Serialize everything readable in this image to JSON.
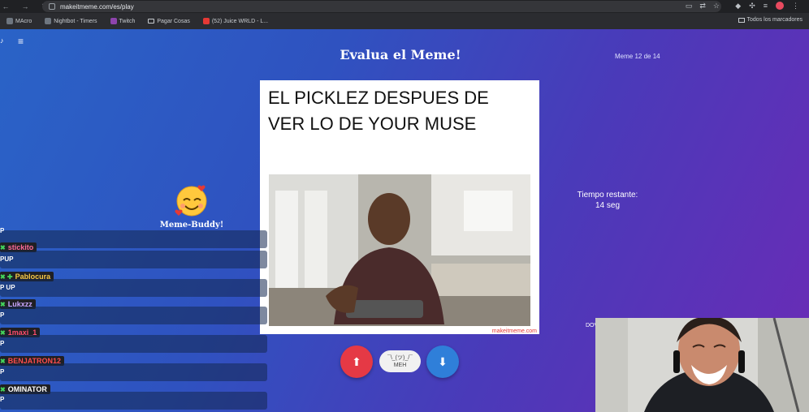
{
  "browser": {
    "url": "makeitmeme.com/es/play",
    "bookmarks": [
      "MAcro",
      "Nightbot - Timers",
      "Twitch",
      "Pagar Cosas",
      "(52) Juice WRLD - L..."
    ],
    "all_bookmarks": "Todos los marcadores"
  },
  "header": {
    "title": "Evalua el Meme!",
    "counter": "Meme 12 de 14"
  },
  "timer": {
    "label": "Tiempo restante:",
    "value": "14 seg"
  },
  "buddy": {
    "label": "Meme-Buddy!"
  },
  "meme": {
    "line1": "EL PICKLEZ DESPUES DE",
    "line2": "VER LO DE  YOUR MUSE",
    "watermark": "makeitmeme.com"
  },
  "vote": {
    "meh_face": "¯\\_(ツ)_/¯",
    "meh_label": "MEH"
  },
  "side_text": "DOV",
  "chat": [
    {
      "user": "",
      "msg": "P"
    },
    {
      "user": "stickito",
      "msg": "PUP",
      "color": "#ff6b9a"
    },
    {
      "user": "Pablocura",
      "msg": "P UP",
      "color": "#f7c948"
    },
    {
      "user": "Lukxzz",
      "msg": "P",
      "color": "#c9a6ff"
    },
    {
      "user": "1maxi_1",
      "msg": "P",
      "color": "#ff4d6d"
    },
    {
      "user": "BENJATRON12",
      "msg": "P",
      "color": "#ff4d4d"
    },
    {
      "user": "OMINATOR",
      "msg": "P",
      "color": "#ffffff"
    }
  ],
  "colors": {
    "upvote": "#e53945",
    "downvote": "#2f7fd9",
    "accent": "#4a3ab9"
  }
}
